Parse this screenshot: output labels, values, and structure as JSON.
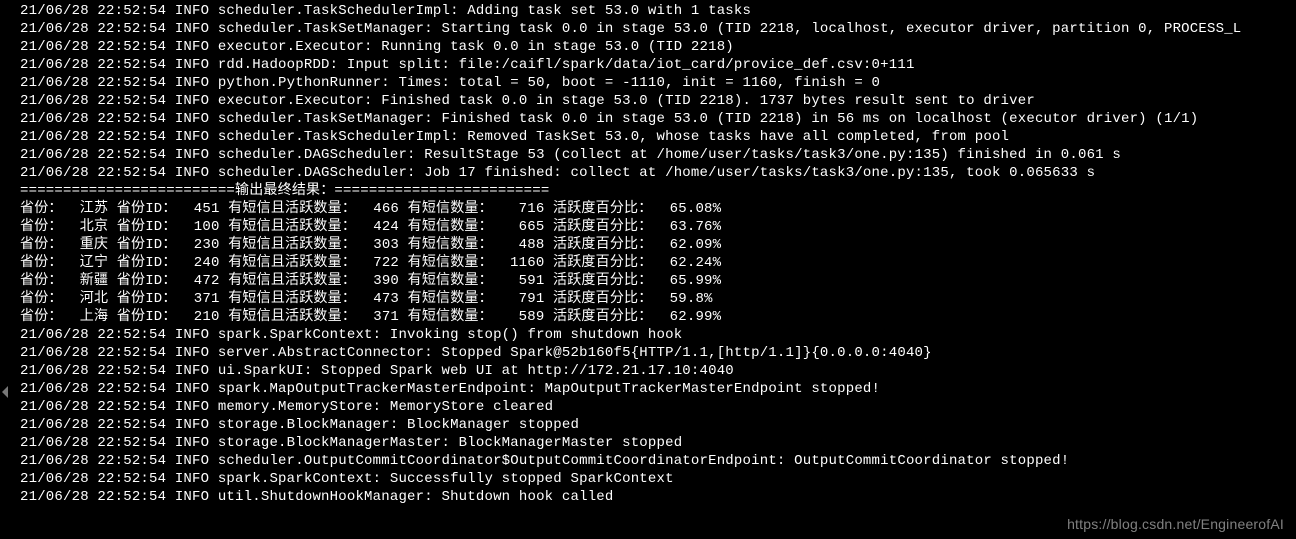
{
  "log_ts": "21/06/28 22:52:54",
  "logs_top": [
    "INFO scheduler.TaskSchedulerImpl: Adding task set 53.0 with 1 tasks",
    "INFO scheduler.TaskSetManager: Starting task 0.0 in stage 53.0 (TID 2218, localhost, executor driver, partition 0, PROCESS_L",
    "INFO executor.Executor: Running task 0.0 in stage 53.0 (TID 2218)",
    "INFO rdd.HadoopRDD: Input split: file:/caifl/spark/data/iot_card/provice_def.csv:0+111",
    "INFO python.PythonRunner: Times: total = 50, boot = -1110, init = 1160, finish = 0",
    "INFO executor.Executor: Finished task 0.0 in stage 53.0 (TID 2218). 1737 bytes result sent to driver",
    "INFO scheduler.TaskSetManager: Finished task 0.0 in stage 53.0 (TID 2218) in 56 ms on localhost (executor driver) (1/1)",
    "INFO scheduler.TaskSchedulerImpl: Removed TaskSet 53.0, whose tasks have all completed, from pool",
    "INFO scheduler.DAGScheduler: ResultStage 53 (collect at /home/user/tasks/task3/one.py:135) finished in 0.061 s",
    "INFO scheduler.DAGScheduler: Job 17 finished: collect at /home/user/tasks/task3/one.py:135, took 0.065633 s"
  ],
  "divider": "=========================输出最终结果：=========================",
  "result_labels": {
    "province": "省份：",
    "province_id": "省份ID：",
    "sms_active": "有短信且活跃数量：",
    "sms_count": "有短信数量：",
    "activity": "活跃度百分比："
  },
  "results": [
    {
      "province": "江苏",
      "province_id": "451",
      "sms_active": "466",
      "sms_count": "716",
      "activity": "65.08%"
    },
    {
      "province": "北京",
      "province_id": "100",
      "sms_active": "424",
      "sms_count": "665",
      "activity": "63.76%"
    },
    {
      "province": "重庆",
      "province_id": "230",
      "sms_active": "303",
      "sms_count": "488",
      "activity": "62.09%"
    },
    {
      "province": "辽宁",
      "province_id": "240",
      "sms_active": "722",
      "sms_count": "1160",
      "activity": "62.24%"
    },
    {
      "province": "新疆",
      "province_id": "472",
      "sms_active": "390",
      "sms_count": "591",
      "activity": "65.99%"
    },
    {
      "province": "河北",
      "province_id": "371",
      "sms_active": "473",
      "sms_count": "791",
      "activity": "59.8%"
    },
    {
      "province": "上海",
      "province_id": "210",
      "sms_active": "371",
      "sms_count": "589",
      "activity": "62.99%"
    }
  ],
  "logs_bottom": [
    "INFO spark.SparkContext: Invoking stop() from shutdown hook",
    "INFO server.AbstractConnector: Stopped Spark@52b160f5{HTTP/1.1,[http/1.1]}{0.0.0.0:4040}",
    "INFO ui.SparkUI: Stopped Spark web UI at http://172.21.17.10:4040",
    "INFO spark.MapOutputTrackerMasterEndpoint: MapOutputTrackerMasterEndpoint stopped!",
    "INFO memory.MemoryStore: MemoryStore cleared",
    "INFO storage.BlockManager: BlockManager stopped",
    "INFO storage.BlockManagerMaster: BlockManagerMaster stopped",
    "INFO scheduler.OutputCommitCoordinator$OutputCommitCoordinatorEndpoint: OutputCommitCoordinator stopped!",
    "INFO spark.SparkContext: Successfully stopped SparkContext",
    "INFO util.ShutdownHookManager: Shutdown hook called"
  ],
  "watermark": "https://blog.csdn.net/EngineerofAI"
}
